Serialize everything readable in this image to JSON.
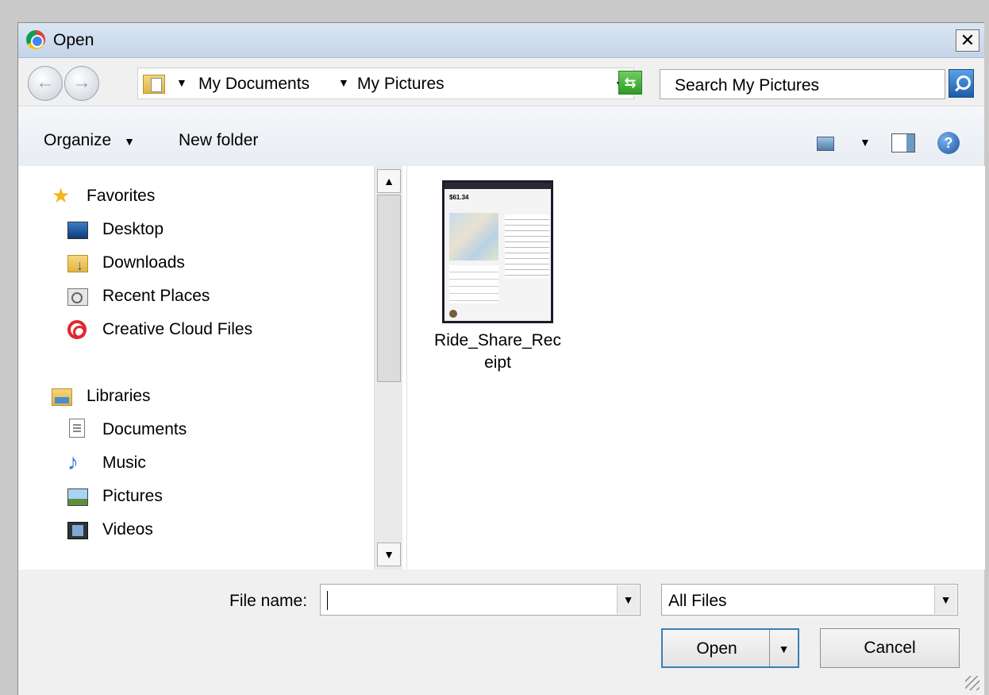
{
  "window": {
    "title": "Open",
    "close_glyph": "✕"
  },
  "address_bar": {
    "crumbs": [
      "My Documents",
      "My Pictures"
    ],
    "search_placeholder": "Search My Pictures"
  },
  "toolbar": {
    "organize_label": "Organize",
    "new_folder_label": "New folder",
    "help_glyph": "?"
  },
  "nav": {
    "favorites": {
      "label": "Favorites",
      "items": [
        "Desktop",
        "Downloads",
        "Recent Places",
        "Creative Cloud Files"
      ]
    },
    "libraries": {
      "label": "Libraries",
      "items": [
        "Documents",
        "Music",
        "Pictures",
        "Videos"
      ]
    }
  },
  "files": [
    {
      "name": "Ride_Share_Receipt",
      "thumb_price": "$61.34"
    }
  ],
  "bottom": {
    "file_name_label": "File name:",
    "file_name_value": "",
    "file_type_value": "All Files",
    "open_label": "Open",
    "cancel_label": "Cancel"
  },
  "icons": [
    "chrome-icon",
    "close-icon",
    "back-icon",
    "forward-icon",
    "folder-icon",
    "refresh-icon",
    "search-icon",
    "view-icon",
    "preview-pane-icon",
    "help-icon",
    "star-icon",
    "desktop-icon",
    "downloads-icon",
    "recent-places-icon",
    "creative-cloud-icon",
    "libraries-icon",
    "documents-icon",
    "music-icon",
    "pictures-icon",
    "videos-icon"
  ]
}
